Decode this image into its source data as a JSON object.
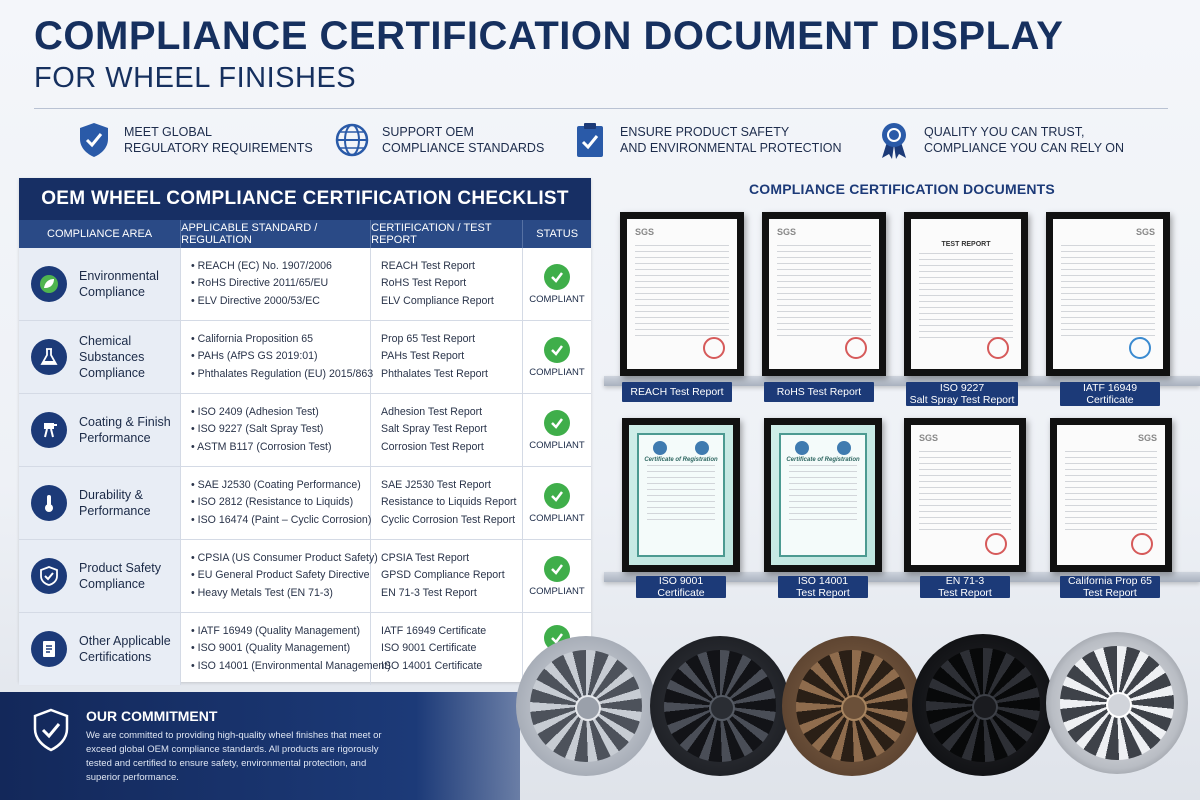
{
  "header": {
    "title": "COMPLIANCE CERTIFICATION DOCUMENT DISPLAY",
    "subtitle": "FOR WHEEL FINISHES"
  },
  "features": [
    {
      "icon": "shield-check-icon",
      "line1": "MEET GLOBAL",
      "line2": "REGULATORY REQUIREMENTS"
    },
    {
      "icon": "globe-icon",
      "line1": "SUPPORT OEM",
      "line2": "COMPLIANCE STANDARDS"
    },
    {
      "icon": "clipboard-check-icon",
      "line1": "ENSURE PRODUCT SAFETY",
      "line2": "AND ENVIRONMENTAL PROTECTION"
    },
    {
      "icon": "award-ribbon-icon",
      "line1": "QUALITY YOU CAN TRUST,",
      "line2": "COMPLIANCE YOU CAN RELY ON"
    }
  ],
  "checklist": {
    "title": "OEM WHEEL COMPLIANCE CERTIFICATION CHECKLIST",
    "columns": [
      "COMPLIANCE AREA",
      "APPLICABLE STANDARD / REGULATION",
      "CERTIFICATION / TEST REPORT",
      "STATUS"
    ],
    "rows": [
      {
        "icon": "leaf-icon",
        "area": "Environmental Compliance",
        "standards": [
          "• REACH (EC) No. 1907/2006",
          "• RoHS Directive 2011/65/EU",
          "• ELV Directive 2000/53/EC"
        ],
        "reports": [
          "REACH Test Report",
          "RoHS Test Report",
          "ELV Compliance Report"
        ],
        "status": "COMPLIANT"
      },
      {
        "icon": "flask-icon",
        "area": "Chemical Substances Compliance",
        "standards": [
          "• California Proposition 65",
          "• PAHs (AfPS GS 2019:01)",
          "• Phthalates Regulation (EU) 2015/863"
        ],
        "reports": [
          "Prop 65 Test Report",
          "PAHs Test Report",
          "Phthalates Test Report"
        ],
        "status": "COMPLIANT"
      },
      {
        "icon": "spray-gun-icon",
        "area": "Coating & Finish Performance",
        "standards": [
          "• ISO 2409 (Adhesion Test)",
          "• ISO 9227 (Salt Spray Test)",
          "• ASTM B117 (Corrosion Test)"
        ],
        "reports": [
          "Adhesion Test Report",
          "Salt Spray Test Report",
          "Corrosion Test Report"
        ],
        "status": "COMPLIANT"
      },
      {
        "icon": "thermometer-icon",
        "area": "Durability & Performance",
        "standards": [
          "• SAE J2530 (Coating Performance)",
          "• ISO 2812 (Resistance to Liquids)",
          "• ISO 16474 (Paint – Cyclic Corrosion)"
        ],
        "reports": [
          "SAE J2530 Test Report",
          "Resistance to Liquids Report",
          "Cyclic Corrosion Test Report"
        ],
        "status": "COMPLIANT"
      },
      {
        "icon": "shield-check-icon",
        "area": "Product Safety Compliance",
        "standards": [
          "• CPSIA (US Consumer Product Safety)",
          "• EU General Product Safety Directive",
          "• Heavy Metals Test (EN 71-3)"
        ],
        "reports": [
          "CPSIA Test Report",
          "GPSD Compliance Report",
          "EN 71-3 Test Report"
        ],
        "status": "COMPLIANT"
      },
      {
        "icon": "document-icon",
        "area": "Other Applicable Certifications",
        "standards": [
          "• IATF 16949 (Quality Management)",
          "• ISO 9001 (Quality Management)",
          "• ISO 14001 (Environmental Management)"
        ],
        "reports": [
          "IATF 16949 Certificate",
          "ISO 9001 Certificate",
          "ISO 14001 Certificate"
        ],
        "status": ""
      }
    ]
  },
  "commitment": {
    "title": "OUR COMMITMENT",
    "body": "We are committed to providing high-quality wheel finishes that meet or exceed global OEM compliance standards. All products are rigorously tested and certified to ensure safety, environmental protection, and superior performance."
  },
  "documents": {
    "title": "COMPLIANCE CERTIFICATION DOCUMENTS",
    "items": [
      {
        "line1": "REACH Test Report",
        "line2": "",
        "kind": "report",
        "brand": "SGS"
      },
      {
        "line1": "RoHS Test Report",
        "line2": "",
        "kind": "report",
        "brand": "SGS"
      },
      {
        "line1": "ISO 9227",
        "line2": "Salt Spray Test Report",
        "kind": "report",
        "brand": "TEST REPORT"
      },
      {
        "line1": "IATF 16949",
        "line2": "Certificate",
        "kind": "report",
        "brand": "SGS"
      },
      {
        "line1": "ISO 9001",
        "line2": "Certificate",
        "kind": "cert",
        "brand": "Certificate of Registration"
      },
      {
        "line1": "ISO 14001",
        "line2": "Test Report",
        "kind": "cert",
        "brand": "Certificate of Registration"
      },
      {
        "line1": "EN 71-3",
        "line2": "Test Report",
        "kind": "report",
        "brand": "SGS"
      },
      {
        "line1": "California Prop 65",
        "line2": "Test Report",
        "kind": "report",
        "brand": "SGS"
      }
    ]
  },
  "colors": {
    "navy": "#172f64",
    "header_blue": "#2a4a86",
    "compliant_green": "#3fae4a"
  }
}
